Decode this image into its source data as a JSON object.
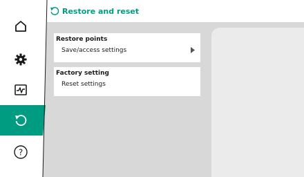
{
  "colors": {
    "accent": "#009c82",
    "content_bg": "#d8d8d8",
    "card_bg": "#ffffff",
    "preview_bg": "#ebebeb",
    "icon": "#1a1a1a"
  },
  "sidebar": {
    "items": [
      {
        "icon": "home-icon",
        "selected": false
      },
      {
        "icon": "gear-icon",
        "selected": false
      },
      {
        "icon": "diagnostics-icon",
        "selected": false
      },
      {
        "icon": "restore-icon",
        "selected": true
      },
      {
        "icon": "help-icon",
        "selected": false
      }
    ]
  },
  "header": {
    "icon": "restore-icon",
    "title": "Restore and reset"
  },
  "menu": {
    "items": [
      {
        "title": "Restore points",
        "subtitle": "Save/access settings",
        "has_chevron": true
      },
      {
        "title": "Factory setting",
        "subtitle": "Reset settings",
        "has_chevron": false
      }
    ]
  }
}
